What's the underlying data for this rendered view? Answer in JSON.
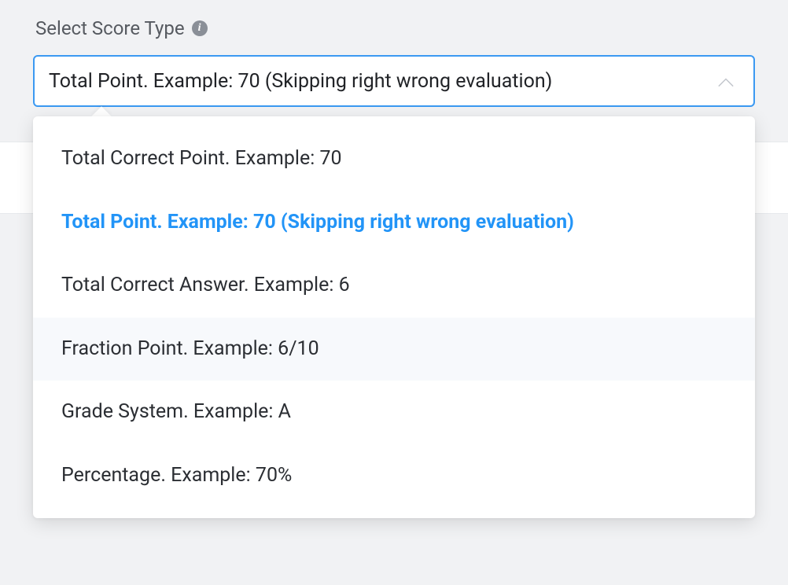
{
  "field": {
    "label": "Select Score Type",
    "selected_value": "Total Point. Example: 70 (Skipping right wrong evaluation)",
    "selected_index": 1,
    "hovered_index": 3
  },
  "options": [
    {
      "label": "Total Correct Point. Example: 70"
    },
    {
      "label": "Total Point. Example: 70 (Skipping right wrong evaluation)"
    },
    {
      "label": "Total Correct Answer. Example: 6"
    },
    {
      "label": "Fraction Point. Example: 6/10"
    },
    {
      "label": "Grade System. Example: A"
    },
    {
      "label": "Percentage. Example: 70%"
    }
  ]
}
